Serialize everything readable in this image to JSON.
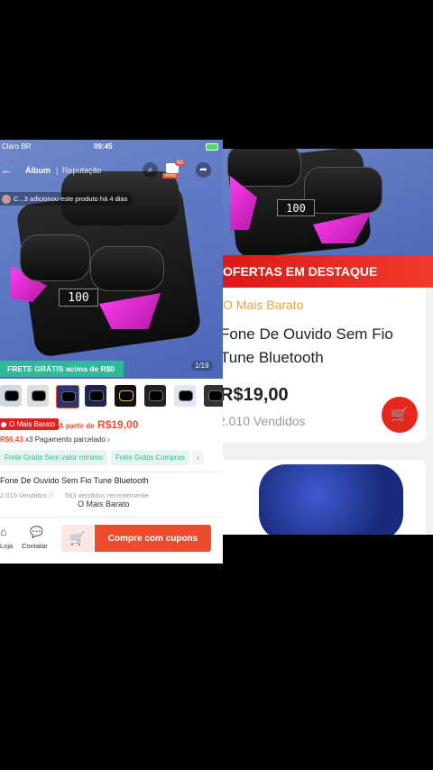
{
  "status": {
    "carrier": "Claro BR",
    "time": "09:45"
  },
  "nav": {
    "album": "Álbum",
    "reputation": "Reputação",
    "cart_badge": "60",
    "cart_sub": "vento"
  },
  "notice": {
    "text": "C...3 adicionou este produto há 4 dias"
  },
  "hero": {
    "frete_label": "FRETE GRÁTIS acima de R$0",
    "counter": "1/19"
  },
  "price": {
    "seller_badge": "O Mais Barato",
    "from_label": "A partir de",
    "value": "R$19,00",
    "installment_value": "R$6,43",
    "installment_text": "x3 Pagamento parcelado",
    "installment_arrow": "›"
  },
  "tags": [
    "Frete Grátis Sem valor mínimo",
    "Frete Grátis Compras",
    "›"
  ],
  "product": {
    "title": "Fone De Ouvido Sem Fio Tune  Bluetooth",
    "sold": "2.010 Vendidos",
    "recent": "563 vendidos recentemente",
    "store": "O Mais Barato"
  },
  "bottom": {
    "loja": "Loja",
    "contatar": "Contatar",
    "buy_label": "Compre com cupons"
  },
  "right": {
    "banner": "OFERTAS EM DESTAQUE",
    "seller": "O Mais Barato",
    "title_line1": "Fone De Ouvido Sem Fio",
    "title_line2": "Tune Bluetooth",
    "price": "R$19,00",
    "sold": "2.010 Vendidos"
  },
  "colors": {
    "accent": "#ee4d2d",
    "teal": "#2fb89a",
    "banner_red": "#e02020",
    "seller_orange": "#e8a33b"
  }
}
